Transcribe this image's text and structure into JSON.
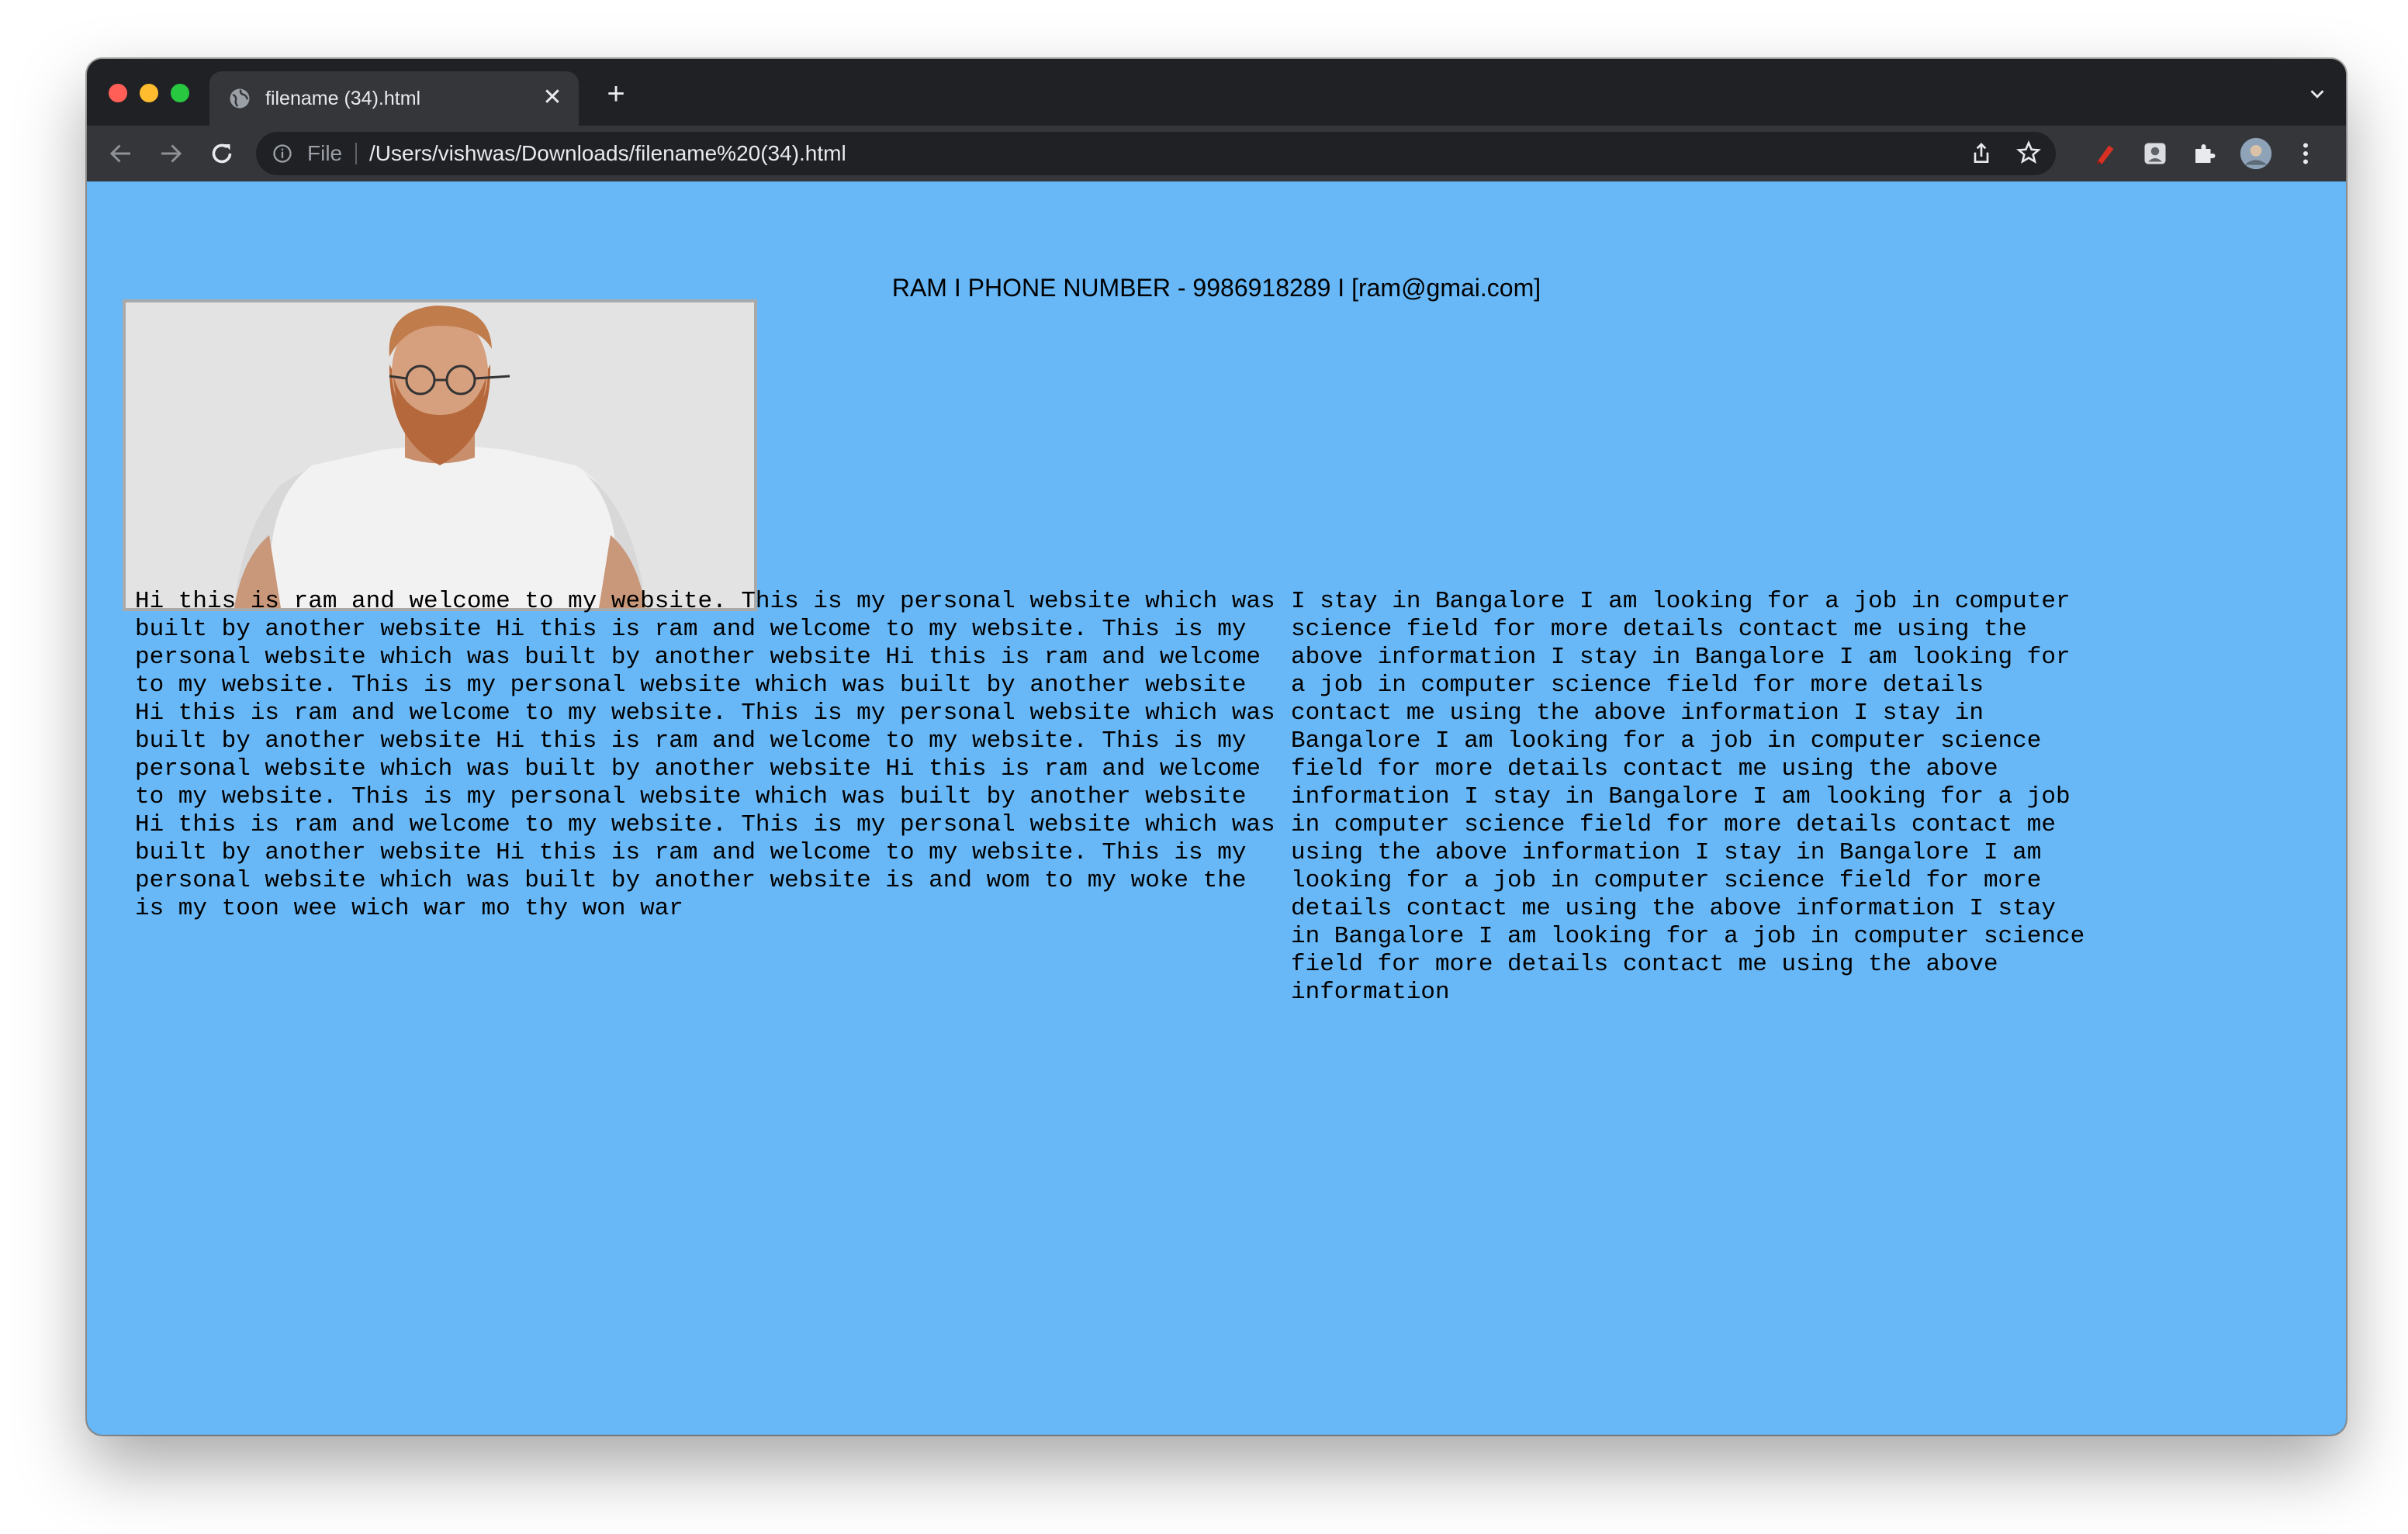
{
  "browser": {
    "tab_title": "filename (34).html",
    "new_tab_label": "+",
    "close_label": "✕",
    "scheme_label": "File",
    "url": "/Users/vishwas/Downloads/filename%20(34).html"
  },
  "page": {
    "background_color": "#68b8f8",
    "contact_line": "RAM I PHONE NUMBER - 9986918289 I [ram@gmai.com]",
    "left_text": "Hi this is ram and welcome to my website. This is my personal website which was built by another website Hi this is ram and welcome to my website. This is my personal website which was built by another website Hi this is ram and welcome to my website. This is my personal website which was built by another website Hi this is ram and welcome to my website. This is my personal website which was built by another website Hi this is ram and welcome to my website. This is my personal website which was built by another website Hi this is ram and welcome to my website. This is my personal website which was built by another website Hi this is ram and welcome to my website. This is my personal website which was built by another website Hi this is ram and welcome to my website. This is my personal website which was built by another website is and wom to my woke the is my toon wee wich war mo thy won war",
    "right_text": "I stay in Bangalore I am looking for a job in computer science field for more details contact me using the above information I stay in Bangalore I am looking for a job in computer science field for more details contact me using the above information I stay in Bangalore I am looking for a job in computer science field for more details contact me using the above information I stay in Bangalore I am looking for a job in computer science field for more details contact me using the above information I stay in Bangalore I am looking for a job in computer science field for more details contact me using the above information I stay in Bangalore I am looking for a job in computer science field for more details contact me using the above information"
  }
}
